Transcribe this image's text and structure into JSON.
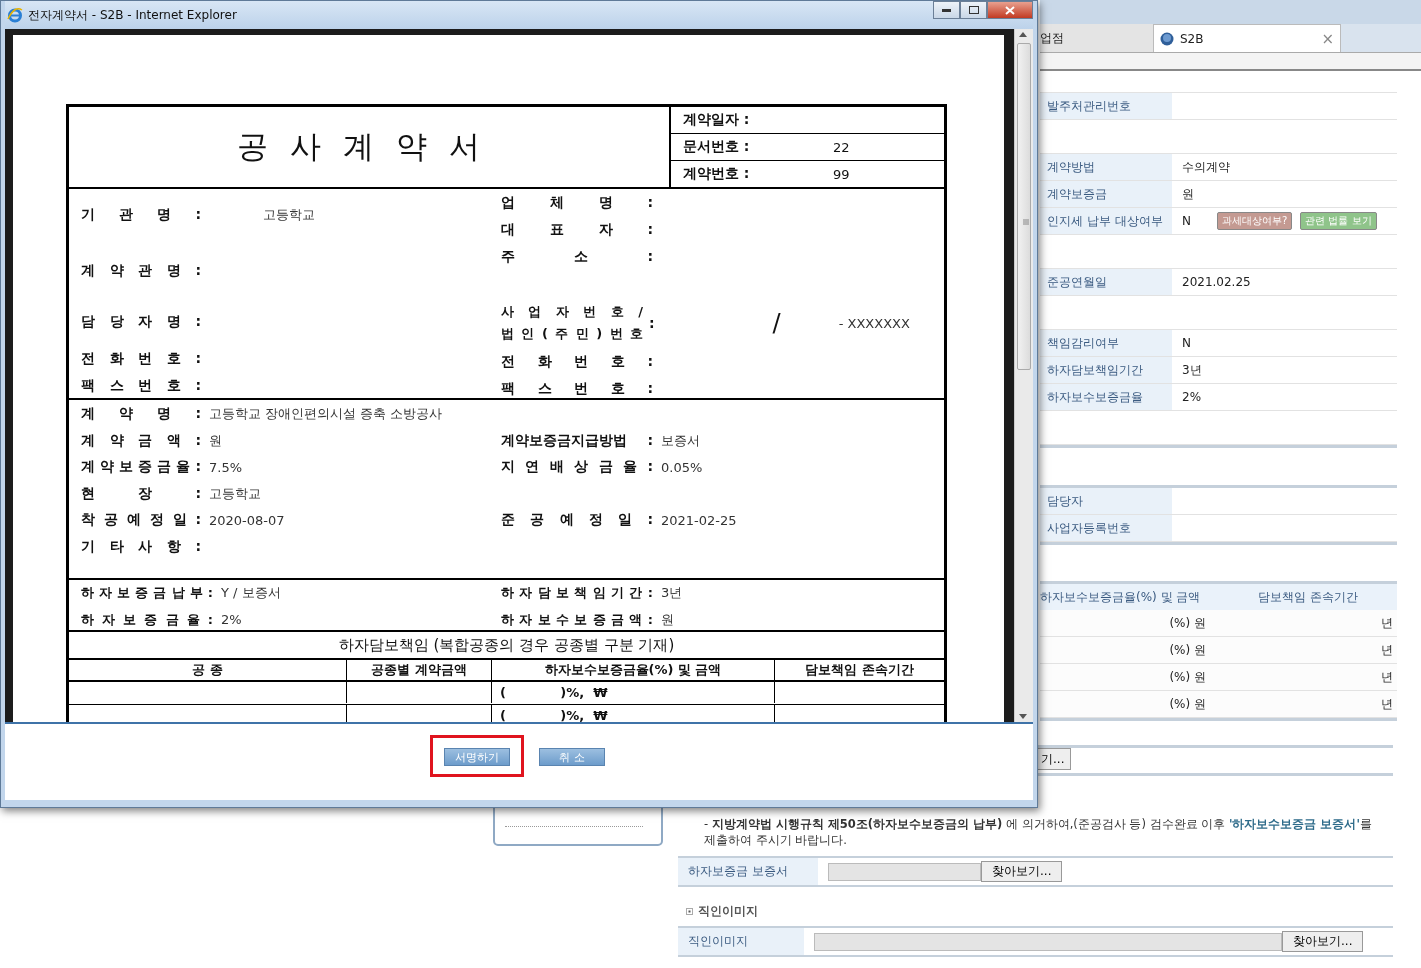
{
  "popup": {
    "title": "전자계약서 - S2B - Internet Explorer",
    "document": {
      "title": "공사계약서",
      "meta": [
        {
          "label": "계약일자 :"
        },
        {
          "label": "문서번호 :",
          "value": "22"
        },
        {
          "label": "계약번호 :",
          "value": "99"
        }
      ],
      "parties_left": [
        {
          "label": "기 관 명 :",
          "value": "고등학교"
        },
        {
          "label": "계 약 관 명 :"
        },
        {
          "label": "담 당 자 명 :"
        },
        {
          "label": "전 화 번 호 :"
        },
        {
          "label": "팩 스 번 호 :"
        }
      ],
      "parties_right": [
        {
          "label": "업 체 명 :"
        },
        {
          "label": "대 표 자 :"
        },
        {
          "label": "주 소 :"
        },
        {
          "lines": [
            "사 업 자 번 호 /",
            "법 인 ( 주 민 ) 번 호"
          ],
          "colon": ":",
          "value": "/",
          "value_2": "- XXXXXXX"
        },
        {
          "label": "전 화 번 호 :"
        },
        {
          "label": "팩 스 번 호 :"
        }
      ],
      "terms": [
        {
          "left": {
            "label": "계 약 명 :",
            "value": "고등학교 장애인편의시설 증축 소방공사"
          }
        },
        {
          "left": {
            "label": "계 약 금 액 :",
            "value": "원"
          },
          "right": {
            "label": "계약보증금지급방법 :",
            "value": "보증서"
          }
        },
        {
          "left": {
            "label": "계 약 보 증 금 율 :",
            "value": "7.5%"
          },
          "right": {
            "label": "지 연 배 상 금 율 :",
            "value": "0.05%"
          }
        },
        {
          "left": {
            "label": "현 장 :",
            "value": "고등학교"
          }
        },
        {
          "left": {
            "label": "착 공 예 정 일 :",
            "value": "2020-08-07"
          },
          "right": {
            "label": "준 공 예 정 일 :",
            "value": "2021-02-25"
          }
        },
        {
          "left": {
            "label": "기 타 사 항 :"
          }
        }
      ],
      "warranty": [
        {
          "left": {
            "label": "하 자 보 증 금 납 부 :",
            "value": "Y /  보증서"
          },
          "right": {
            "label": "하 자 담 보 책 임 기 간 :",
            "value": "3년"
          }
        },
        {
          "left": {
            "label": "하 자 보 증 금 율 :",
            "value": "2%"
          },
          "right": {
            "label": "하 자 보 수 보 증 금 액 :",
            "value": "원"
          }
        }
      ],
      "warranty_title": "하자담보책임 (복합공종의 경우 공종별 구분 기재)",
      "table": {
        "columns": [
          "공 종",
          "공종별 계약금액",
          "하자보수보증금율(%) 및 금액",
          "담보책임 존속기간"
        ],
        "rows": [
          {
            "rate": "(            )%,  ₩"
          },
          {
            "rate": "(            )%,  ₩"
          }
        ]
      }
    },
    "buttons": [
      {
        "label": "서명하기",
        "highlighted": true
      },
      {
        "label": "취 소",
        "highlighted": false
      }
    ]
  },
  "browser": {
    "tabs": [
      {
        "label": "업점",
        "selected": false
      },
      {
        "label": "S2B",
        "selected": true,
        "close": "×"
      }
    ],
    "info_rows": [
      {
        "kind": "cut"
      },
      {
        "kind": "field",
        "label": "발주처관리번호"
      },
      {
        "kind": "spacer"
      },
      {
        "kind": "field",
        "label": "계약방법",
        "value": "수의계약"
      },
      {
        "kind": "field",
        "label": "계약보증금",
        "value": "원"
      },
      {
        "kind": "field",
        "label": "인지세 납부 대상여부",
        "value": "N",
        "actions": [
          "과세대상여부?",
          "관련 법률 보기"
        ]
      },
      {
        "kind": "spacer"
      },
      {
        "kind": "field",
        "label": "준공연월일",
        "value": "2021.02.25"
      },
      {
        "kind": "spacer"
      },
      {
        "kind": "field",
        "label": "책임감리여부",
        "value": "N"
      },
      {
        "kind": "field",
        "label": "하자담보책임기간",
        "value": "3년"
      },
      {
        "kind": "field",
        "label": "하자보수보증금율",
        "value": "2%"
      },
      {
        "kind": "spacer"
      }
    ],
    "contact_rows": [
      {
        "label": "담당자"
      },
      {
        "label": "사업자등록번호"
      }
    ],
    "warranty_table": {
      "columns": [
        "하자보수보증금율(%) 및 금액",
        "담보책임 존속기간"
      ],
      "rows": [
        {
          "amount": "(%) 원",
          "period": "년"
        },
        {
          "amount": "(%) 원",
          "period": "년"
        },
        {
          "amount": "(%) 원",
          "period": "년"
        },
        {
          "amount": "(%) 원",
          "period": "년"
        }
      ]
    },
    "cut_button": "기...",
    "notice": "- **지방계약법 시행규칙 제50조(하자보수보증금의 납부)** 에 의거하여,(준공검사 등) 검수완료 이후 **'하자보수보증금 보증서'**를 제출하여 주시기 바랍니다.",
    "upload_row": {
      "label": "하자보증금 보증서",
      "button": "찾아보기..."
    },
    "seal_heading": "직인이미지",
    "seal_row": {
      "label": "직인이미지",
      "button": "찾아보기..."
    }
  }
}
